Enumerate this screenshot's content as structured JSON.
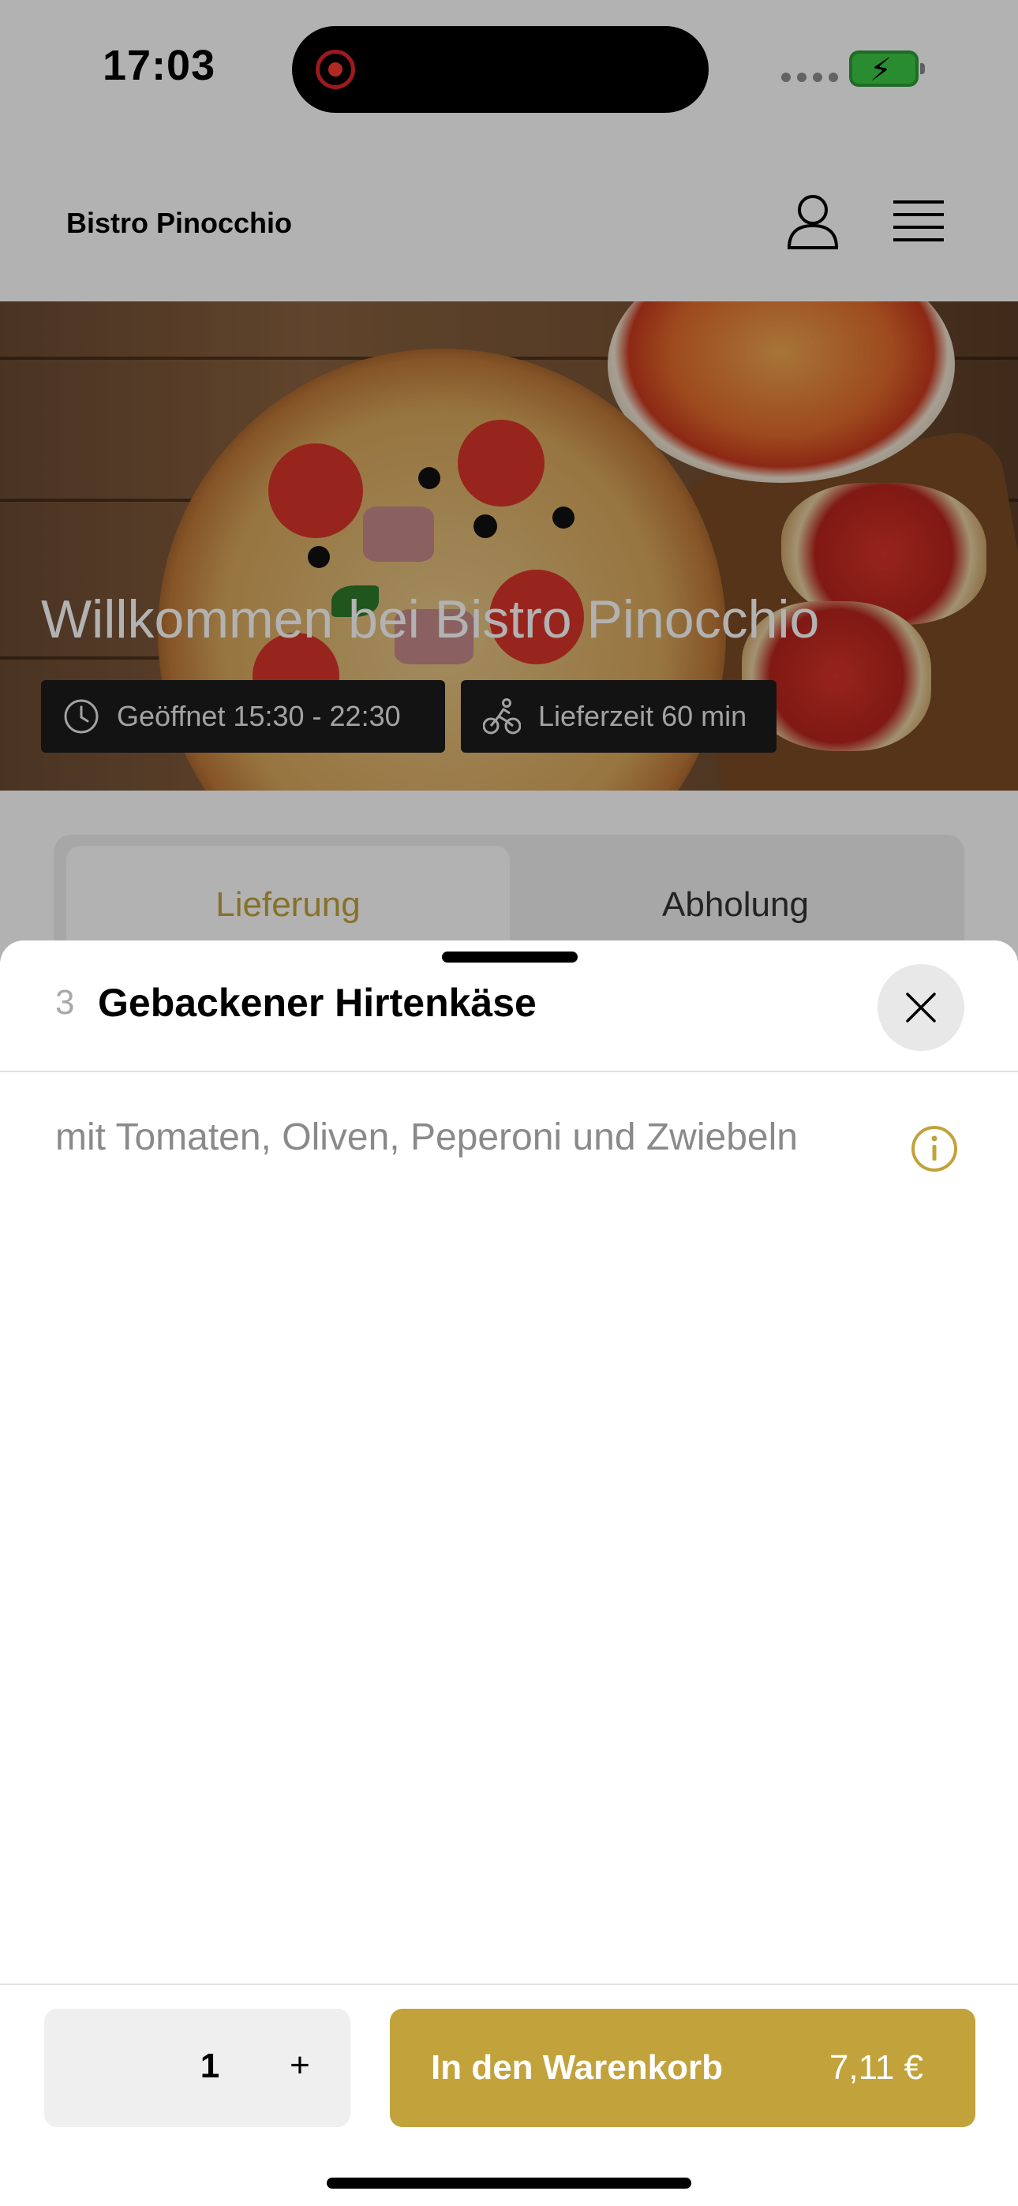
{
  "status_bar": {
    "time": "17:03"
  },
  "header": {
    "brand": "Bistro Pinocchio",
    "icons": [
      "profile-icon",
      "hamburger-menu-icon"
    ]
  },
  "hero": {
    "title": "Willkommen bei Bistro Pinocchio",
    "opening_hours": "Geöffnet 15:30 - 22:30",
    "delivery_time": "Lieferzeit 60 min",
    "icons": [
      "clock-icon",
      "cyclist-icon"
    ]
  },
  "order_mode_tabs": {
    "delivery": "Lieferung",
    "pickup": "Abholung",
    "selected": "delivery"
  },
  "sheet": {
    "dish_number": "3",
    "dish_title": "Gebackener Hirtenkäse",
    "description": "mit Tomaten, Oliven, Peperoni und Zwiebeln",
    "icons": [
      "close-icon",
      "info-icon"
    ]
  },
  "footer": {
    "quantity": "1",
    "plus_label": "+",
    "add_to_cart_label": "In den Warenkorb",
    "price": "7,11 €"
  },
  "colors": {
    "accent": "#c2a23a",
    "dim_overlay": "rgba(0,0,0,0.30)",
    "badge_bg": "#1c1c1c"
  }
}
